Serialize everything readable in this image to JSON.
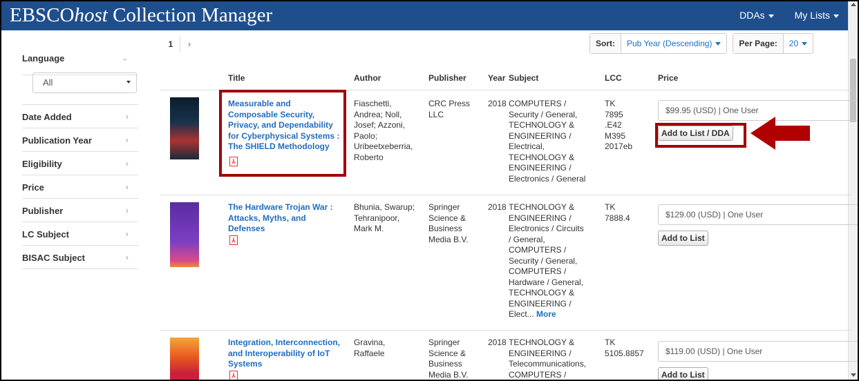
{
  "header": {
    "brand_prefix": "EBSCO",
    "brand_host": "host",
    "brand_suffix": " Collection Manager",
    "nav": [
      "DDAs",
      "My Lists"
    ]
  },
  "sidebar": {
    "language_label": "Language",
    "language_value": "All",
    "items": [
      "Date Added",
      "Publication Year",
      "Eligibility",
      "Price",
      "Publisher",
      "LC Subject",
      "BISAC Subject"
    ]
  },
  "pager": {
    "current": "1",
    "next": "›"
  },
  "sort": {
    "sort_label": "Sort:",
    "sort_value": "Pub Year (Descending)",
    "per_page_label": "Per Page:",
    "per_page_value": "20"
  },
  "table": {
    "columns": [
      "Title",
      "Author",
      "Publisher",
      "Year",
      "Subject",
      "LCC",
      "Price"
    ],
    "rows": [
      {
        "title_lines": [
          "Measurable and",
          "Composable Security,",
          "Privacy, and Dependability",
          "for Cyberphysical Systems :",
          "The SHIELD Methodology"
        ],
        "author_lines": [
          "Fiaschetti,",
          "Andrea; Noll,",
          "Josef; Azzoni,",
          "Paolo;",
          "Uribeetxeberria,",
          "Roberto"
        ],
        "publisher_lines": [
          "CRC Press",
          "LLC"
        ],
        "year": "2018",
        "subject_lines": [
          "COMPUTERS /",
          "Security / General,",
          "TECHNOLOGY &",
          "ENGINEERING /",
          "Electrical,",
          "TECHNOLOGY &",
          "ENGINEERING /",
          "Electronics / General"
        ],
        "lcc_lines": [
          "TK",
          "7895",
          ".E42",
          "M395",
          "2017eb"
        ],
        "price": "$99.95 (USD) | One User",
        "button": "Add to List / DDA"
      },
      {
        "title_lines": [
          "The Hardware Trojan War :",
          "Attacks, Myths, and",
          "Defenses"
        ],
        "author_lines": [
          "Bhunia, Swarup;",
          "Tehranipoor,",
          "Mark M."
        ],
        "publisher_lines": [
          "Springer",
          "Science &",
          "Business",
          "Media B.V."
        ],
        "year": "2018",
        "subject_lines": [
          "TECHNOLOGY &",
          "ENGINEERING /",
          "Electronics / Circuits",
          "/ General,",
          "COMPUTERS /",
          "Security / General,",
          "COMPUTERS /",
          "Hardware / General,",
          "TECHNOLOGY &",
          "ENGINEERING /",
          "Elect..."
        ],
        "more_label": "More",
        "lcc_lines": [
          "TK",
          "7888.4"
        ],
        "price": "$129.00 (USD) | One User",
        "button": "Add to List"
      },
      {
        "title_lines": [
          "Integration, Interconnection,",
          "and Interoperability of IoT",
          "Systems"
        ],
        "author_lines": [
          "Gravina,",
          "Raffaele"
        ],
        "publisher_lines": [
          "Springer",
          "Science &",
          "Business",
          "Media B.V."
        ],
        "year": "2018",
        "subject_lines": [
          "TECHNOLOGY &",
          "ENGINEERING /",
          "Telecommunications,",
          "COMPUTERS /"
        ],
        "lcc_lines": [
          "TK",
          "5105.8857"
        ],
        "price": "$119.00 (USD) | One User",
        "button": "Add to List"
      }
    ]
  },
  "highlight_color": "#a00000",
  "link_color": "#1f6dbf",
  "header_color": "#1f4e8c"
}
